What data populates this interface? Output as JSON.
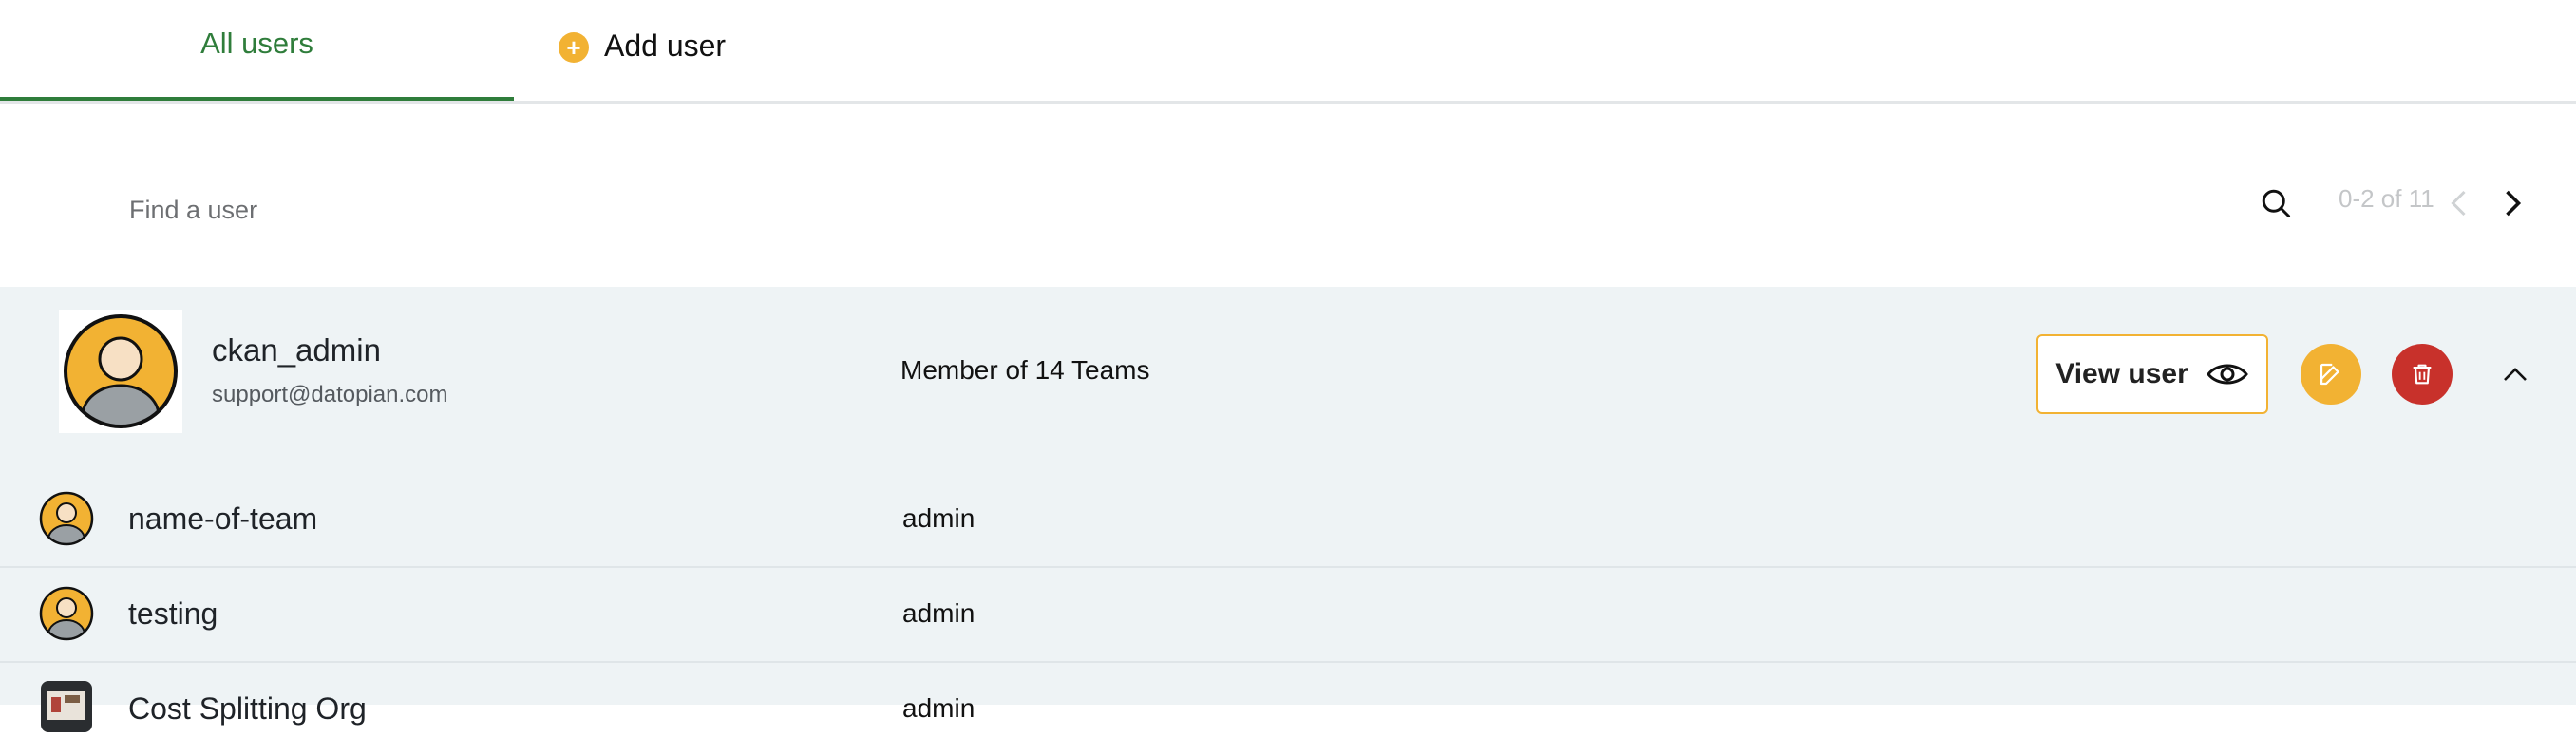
{
  "tabs": {
    "all_users": "All users",
    "add_user": "Add user"
  },
  "search": {
    "placeholder": "Find a user",
    "value": ""
  },
  "pagination": {
    "range_text": "0-2 of 11"
  },
  "user": {
    "name": "ckan_admin",
    "email": "support@datopian.com",
    "membership": "Member of 14 Teams",
    "view_label": "View user"
  },
  "teams": [
    {
      "name": "name-of-team",
      "role": "admin",
      "avatar": "user-avatar-icon"
    },
    {
      "name": "testing",
      "role": "admin",
      "avatar": "user-avatar-icon"
    },
    {
      "name": "Cost Splitting Org",
      "role": "admin",
      "avatar": "org-image-icon"
    }
  ],
  "colors": {
    "accent_green": "#2f7d3b",
    "accent_yellow": "#f2b233",
    "danger_red": "#c8312b",
    "panel_bg": "#eef3f5"
  }
}
